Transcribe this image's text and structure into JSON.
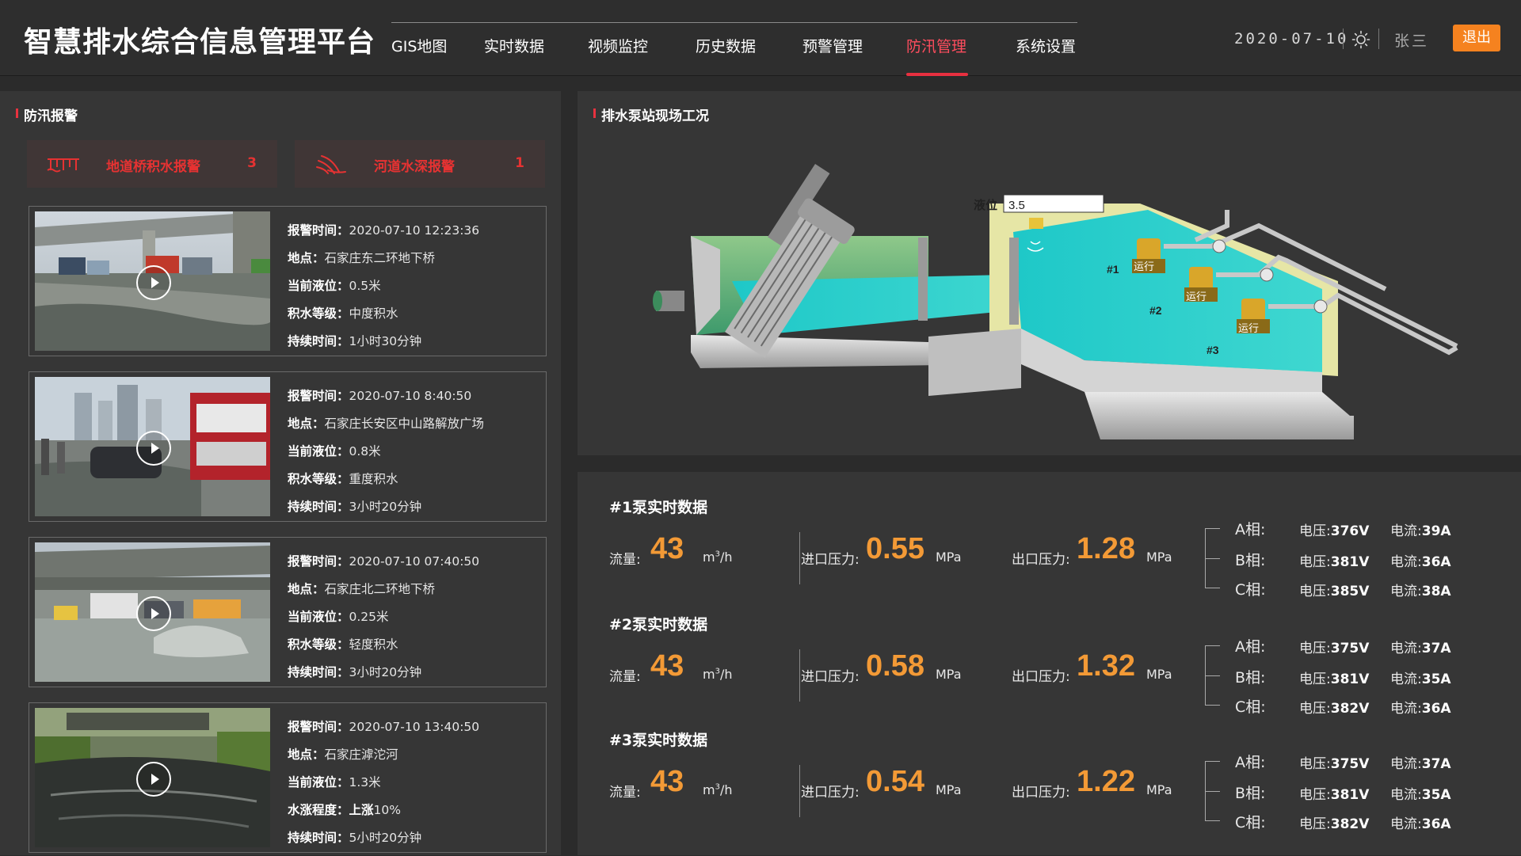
{
  "header": {
    "title": "智慧排水综合信息管理平台",
    "nav": [
      {
        "label": "GIS地图",
        "active": false
      },
      {
        "label": "实时数据",
        "active": false
      },
      {
        "label": "视频监控",
        "active": false
      },
      {
        "label": "历史数据",
        "active": false
      },
      {
        "label": "预警管理",
        "active": false
      },
      {
        "label": "防汛管理",
        "active": true
      },
      {
        "label": "系统设置",
        "active": false
      }
    ],
    "date": "2020-07-10",
    "user": "张三",
    "logout": "退出",
    "accent_color": "#e8323f",
    "logout_color": "#f5821f"
  },
  "alarm_panel": {
    "title": "防汛报警",
    "tabs": [
      {
        "label": "地道桥积水报警",
        "count": "3",
        "icon": "underpass-icon"
      },
      {
        "label": "河道水深报警",
        "count": "1",
        "icon": "river-wave-icon"
      }
    ],
    "cards": [
      {
        "rows": [
          {
            "label": "报警时间：",
            "value": "2020-07-10  12:23:36"
          },
          {
            "label": "地点：",
            "value": "石家庄东二环地下桥"
          },
          {
            "label": "当前液位：",
            "value": "0.5米"
          },
          {
            "label": "积水等级：",
            "value": "中度积水"
          },
          {
            "label": "持续时间：",
            "value": "1小时30分钟"
          }
        ]
      },
      {
        "rows": [
          {
            "label": "报警时间：",
            "value": "2020-07-10  8:40:50"
          },
          {
            "label": "地点：",
            "value": "石家庄长安区中山路解放广场"
          },
          {
            "label": "当前液位：",
            "value": "0.8米"
          },
          {
            "label": "积水等级：",
            "value": "重度积水"
          },
          {
            "label": "持续时间：",
            "value": "3小时20分钟"
          }
        ]
      },
      {
        "rows": [
          {
            "label": "报警时间：",
            "value": "2020-07-10  07:40:50"
          },
          {
            "label": "地点：",
            "value": "石家庄北二环地下桥"
          },
          {
            "label": "当前液位：",
            "value": "0.25米"
          },
          {
            "label": "积水等级：",
            "value": "轻度积水"
          },
          {
            "label": "持续时间：",
            "value": "3小时20分钟"
          }
        ]
      },
      {
        "rows": [
          {
            "label": "报警时间：",
            "value": "2020-07-10  13:40:50"
          },
          {
            "label": "地点：",
            "value": "石家庄滹沱河"
          },
          {
            "label": "当前液位：",
            "value": "1.3米"
          },
          {
            "label": "水涨程度：",
            "value": "上涨",
            "value2": "10%"
          },
          {
            "label": "持续时间：",
            "value": "5小时20分钟"
          }
        ]
      }
    ]
  },
  "scene_panel": {
    "title": "排水泵站现场工况",
    "level_label": "液位",
    "level_value": "3.5",
    "pump_tags": [
      "#1",
      "#2",
      "#3"
    ],
    "pump_status": "运行"
  },
  "pumps": [
    {
      "title": "#1泵实时数据",
      "flow_label": "流量:",
      "flow": "43",
      "flow_unit": "m",
      "flow_unit_sup": "3",
      "flow_unit_tail": "/h",
      "in_label": "进口压力:",
      "in_pressure": "0.55",
      "in_unit": "MPa",
      "out_label": "出口压力:",
      "out_pressure": "1.28",
      "out_unit": "MPa",
      "phases": [
        {
          "name": "A相:",
          "v_label": "电压:",
          "v": "376V",
          "a_label": "电流:",
          "a": "39A"
        },
        {
          "name": "B相:",
          "v_label": "电压:",
          "v": "381V",
          "a_label": "电流:",
          "a": "36A"
        },
        {
          "name": "C相:",
          "v_label": "电压:",
          "v": "385V",
          "a_label": "电流:",
          "a": "38A"
        }
      ]
    },
    {
      "title": "#2泵实时数据",
      "flow_label": "流量:",
      "flow": "43",
      "flow_unit": "m",
      "flow_unit_sup": "3",
      "flow_unit_tail": "/h",
      "in_label": "进口压力:",
      "in_pressure": "0.58",
      "in_unit": "MPa",
      "out_label": "出口压力:",
      "out_pressure": "1.32",
      "out_unit": "MPa",
      "phases": [
        {
          "name": "A相:",
          "v_label": "电压:",
          "v": "375V",
          "a_label": "电流:",
          "a": "37A"
        },
        {
          "name": "B相:",
          "v_label": "电压:",
          "v": "381V",
          "a_label": "电流:",
          "a": "35A"
        },
        {
          "name": "C相:",
          "v_label": "电压:",
          "v": "382V",
          "a_label": "电流:",
          "a": "36A"
        }
      ]
    },
    {
      "title": "#3泵实时数据",
      "flow_label": "流量:",
      "flow": "43",
      "flow_unit": "m",
      "flow_unit_sup": "3",
      "flow_unit_tail": "/h",
      "in_label": "进口压力:",
      "in_pressure": "0.54",
      "in_unit": "MPa",
      "out_label": "出口压力:",
      "out_pressure": "1.22",
      "out_unit": "MPa",
      "phases": [
        {
          "name": "A相:",
          "v_label": "电压:",
          "v": "375V",
          "a_label": "电流:",
          "a": "37A"
        },
        {
          "name": "B相:",
          "v_label": "电压:",
          "v": "381V",
          "a_label": "电流:",
          "a": "35A"
        },
        {
          "name": "C相:",
          "v_label": "电压:",
          "v": "382V",
          "a_label": "电流:",
          "a": "36A"
        }
      ]
    }
  ]
}
